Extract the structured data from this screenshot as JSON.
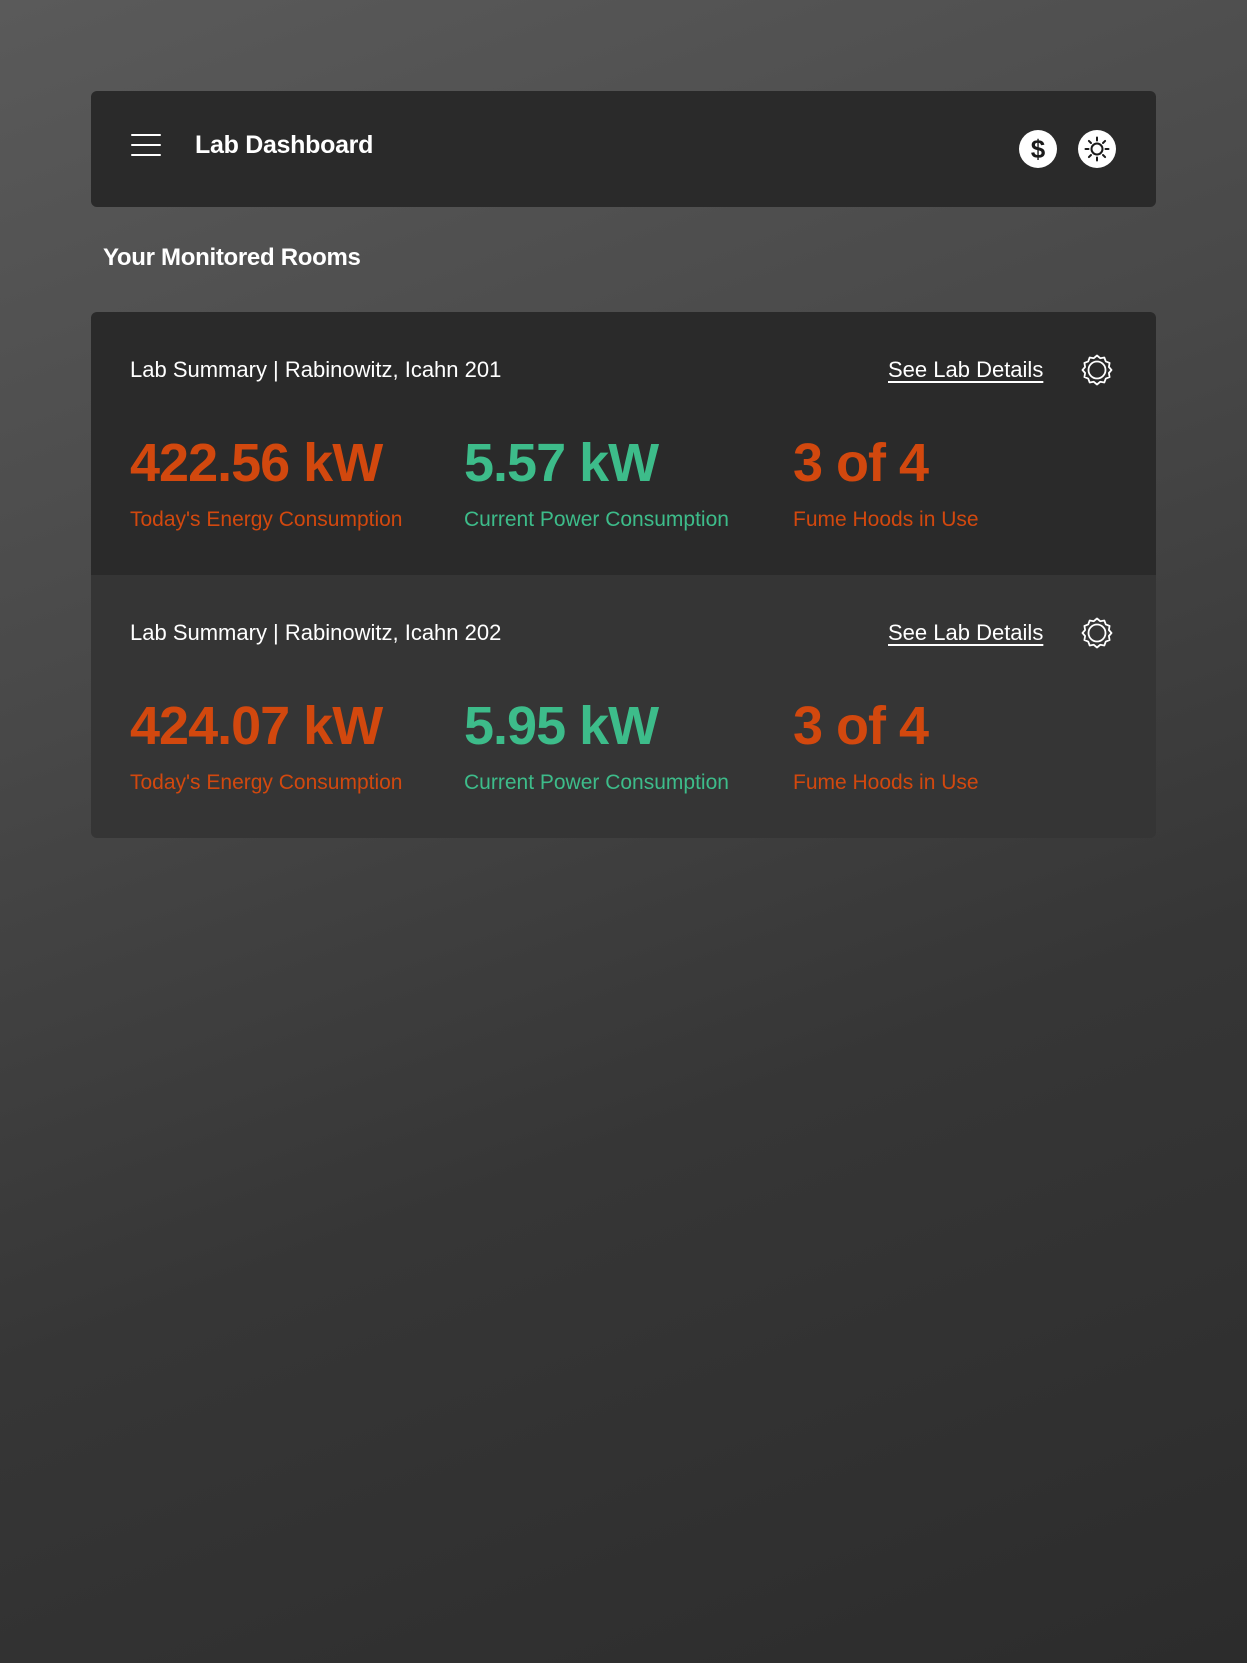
{
  "header": {
    "title": "Lab Dashboard",
    "menu_icon": "hamburger-menu-icon",
    "currency_icon": "dollar-sign-icon",
    "currency_glyph": "$",
    "theme_icon": "sun-icon"
  },
  "section": {
    "title": "Your Monitored Rooms"
  },
  "colors": {
    "energy": "#d2480e",
    "power": "#3dbc8a",
    "hoods": "#d2480e",
    "header_bg": "#2a2a2a"
  },
  "rooms": [
    {
      "title": "Lab Summary | Rabinowitz, Icahn 201",
      "details_label": "See Lab Details",
      "settings_icon": "gear-icon",
      "energy_value": "422.56 kW",
      "energy_label": "Today's Energy Consumption",
      "power_value": "5.57 kW",
      "power_label": "Current Power Consumption",
      "hoods_value": "3 of 4",
      "hoods_label": "Fume Hoods in Use"
    },
    {
      "title": "Lab Summary | Rabinowitz, Icahn 202",
      "details_label": "See Lab Details",
      "settings_icon": "gear-icon",
      "energy_value": "424.07 kW",
      "energy_label": "Today's Energy Consumption",
      "power_value": "5.95 kW",
      "power_label": "Current Power Consumption",
      "hoods_value": "3 of 4",
      "hoods_label": "Fume Hoods in Use"
    }
  ]
}
